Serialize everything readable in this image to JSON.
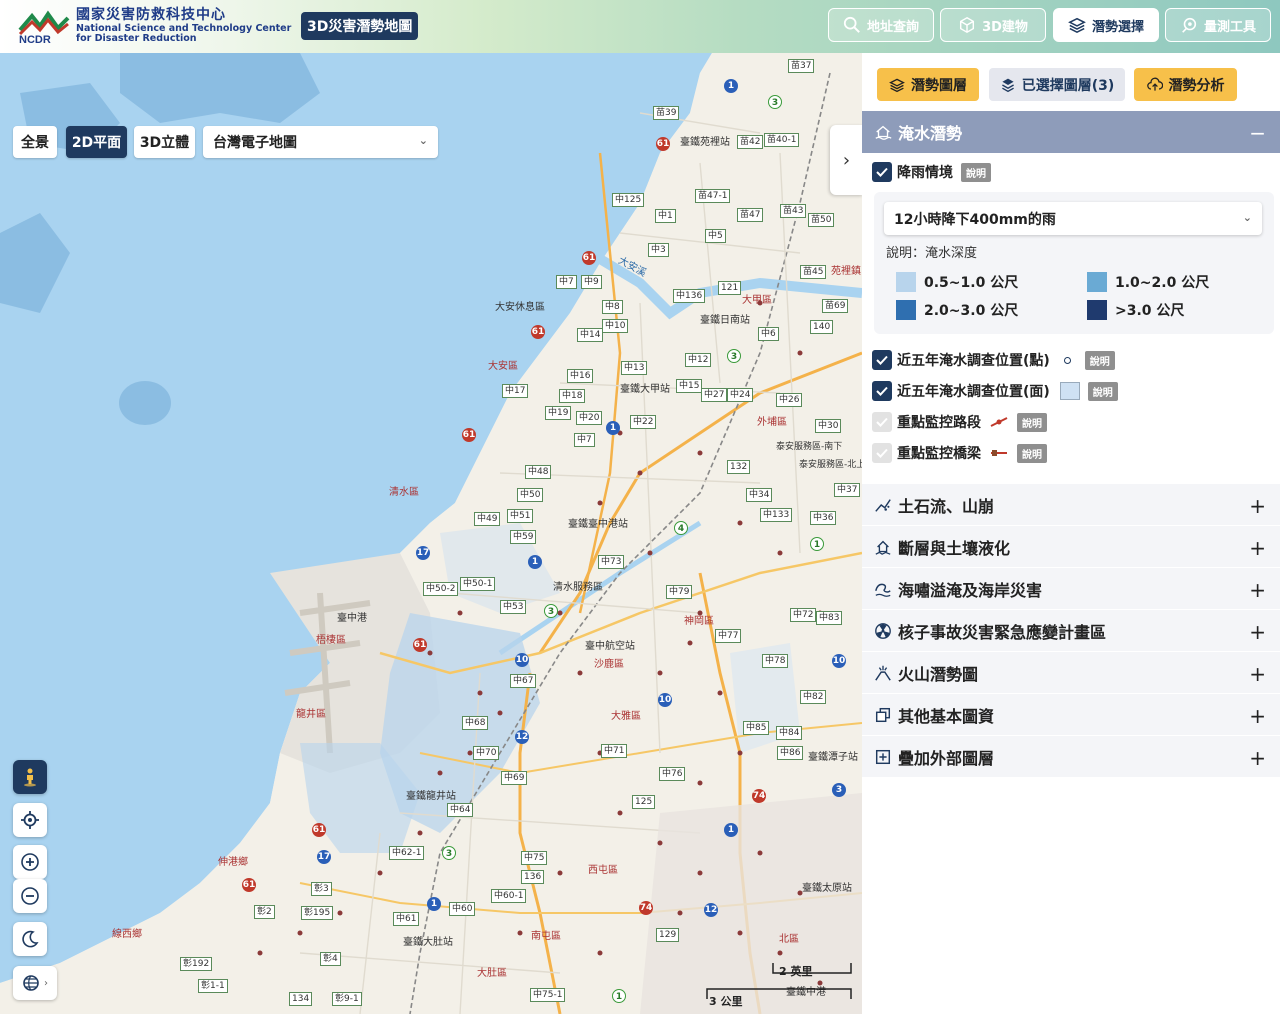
{
  "header": {
    "org_zh": "國家災害防救科技中心",
    "org_en1": "National Science and Technology Center",
    "org_en2": "for Disaster Reduction",
    "logo_text": "NCDR",
    "app_title": "3D災害潛勢地圖",
    "buttons": [
      {
        "label": "地址查詢",
        "icon": "search-icon",
        "active": false
      },
      {
        "label": "3D建物",
        "icon": "cube-icon",
        "active": false
      },
      {
        "label": "潛勢選擇",
        "icon": "layers-icon",
        "active": true
      },
      {
        "label": "量測工具",
        "icon": "measure-icon",
        "active": false
      }
    ]
  },
  "map": {
    "view_buttons": [
      {
        "label": "全景",
        "active": false
      },
      {
        "label": "2D平面",
        "active": true
      },
      {
        "label": "3D立體",
        "active": false
      }
    ],
    "basemap": "台灣電子地圖",
    "scale_imperial": "2 英里",
    "scale_metric": "3 公里",
    "tools": [
      "street-view-icon",
      "locate-icon",
      "zoom-in-icon",
      "zoom-out-icon",
      "dark-mode-icon",
      "globe-icon"
    ],
    "place_labels": [
      {
        "text": "臺鐵苑裡站"
      },
      {
        "text": "大甲區"
      },
      {
        "text": "臺鐵日南站"
      },
      {
        "text": "大安休息區"
      },
      {
        "text": "大安區"
      },
      {
        "text": "臺鐵大甲站"
      },
      {
        "text": "外埔區"
      },
      {
        "text": "清水區"
      },
      {
        "text": "臺鐵臺中港站"
      },
      {
        "text": "清水服務區"
      },
      {
        "text": "臺中港"
      },
      {
        "text": "梧棲區"
      },
      {
        "text": "臺中航空站"
      },
      {
        "text": "沙鹿區"
      },
      {
        "text": "神岡區"
      },
      {
        "text": "大雅區"
      },
      {
        "text": "龍井區"
      },
      {
        "text": "臺鐵龍井站"
      },
      {
        "text": "西屯區"
      },
      {
        "text": "伸港鄉"
      },
      {
        "text": "臺鐵大肚站"
      },
      {
        "text": "南屯區"
      },
      {
        "text": "大肚區"
      },
      {
        "text": "線西鄉"
      },
      {
        "text": "北區"
      },
      {
        "text": "苑裡鎮"
      },
      {
        "text": "臺鐵潭子站"
      },
      {
        "text": "臺鐵太原站"
      },
      {
        "text": "大安溪"
      },
      {
        "text": "泰安服務區-南下"
      },
      {
        "text": "泰安服務區-北上"
      },
      {
        "text": "臺鐵中港"
      }
    ]
  },
  "panel": {
    "tabs": [
      {
        "label": "潛勢圖層",
        "style": "yellow"
      },
      {
        "label": "已選擇圖層(3)",
        "style": "gray"
      },
      {
        "label": "潛勢分析",
        "style": "yellow"
      }
    ],
    "flood": {
      "title": "淹水潛勢",
      "toggle": "−",
      "rain_label": "降雨情境",
      "info": "說明",
      "scenario": "12小時降下400mm的雨",
      "desc": "說明：淹水深度",
      "legend": [
        {
          "label": "0.5~1.0 公尺",
          "color": "#b8d4ec"
        },
        {
          "label": "1.0~2.0 公尺",
          "color": "#6aaad4"
        },
        {
          "label": "2.0~3.0 公尺",
          "color": "#2f6fb0"
        },
        {
          "label": ">3.0 公尺",
          "color": "#1f3a6e"
        }
      ],
      "layers": [
        {
          "label": "近五年淹水調查位置(點)",
          "checked": true,
          "enabled": true
        },
        {
          "label": "近五年淹水調查位置(面)",
          "checked": true,
          "enabled": true
        },
        {
          "label": "重點監控路段",
          "checked": true,
          "enabled": false
        },
        {
          "label": "重點監控橋梁",
          "checked": true,
          "enabled": false
        }
      ]
    },
    "sections": [
      {
        "label": "土石流、山崩",
        "icon": "landslide-icon"
      },
      {
        "label": "斷層與土壤液化",
        "icon": "earthquake-icon"
      },
      {
        "label": "海嘯溢淹及海岸災害",
        "icon": "wave-icon"
      },
      {
        "label": "核子事故災害緊急應變計畫區",
        "icon": "radiation-icon"
      },
      {
        "label": "火山潛勢圖",
        "icon": "volcano-icon"
      },
      {
        "label": "其他基本圖資",
        "icon": "map-stack-icon"
      },
      {
        "label": "疊加外部圖層",
        "icon": "add-layer-icon"
      }
    ],
    "expand_symbol": "+"
  }
}
